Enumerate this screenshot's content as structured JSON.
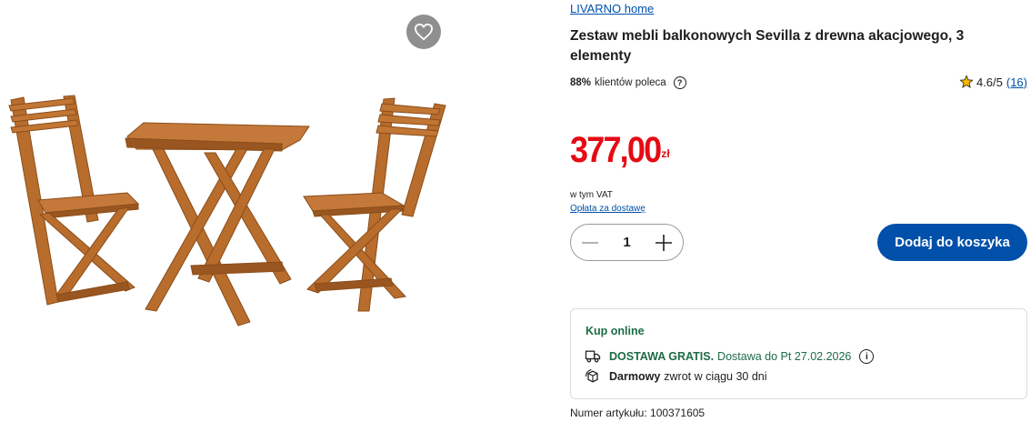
{
  "product": {
    "brand": "LIVARNO home",
    "title": "Zestaw mebli balkonowych Sevilla z drewna akacjowego, 3 elementy",
    "recommend_percent": "88%",
    "recommend_text": "klientów poleca",
    "rating": "4.6/5",
    "review_count": "(16)",
    "price": "377,00",
    "currency": "zł",
    "vat_note": "w tym VAT",
    "shipping_link": "Opłata za dostawę",
    "quantity": "1",
    "add_to_cart_label": "Dodaj do koszyka",
    "article_number": "Numer artykułu: 100371605"
  },
  "delivery": {
    "title": "Kup online",
    "free_shipping": "DOSTAWA GRATIS.",
    "delivery_date": "Dostawa do Pt 27.02.2026",
    "return_bold": "Darmowy",
    "return_text": "zwrot w ciągu 30 dni"
  },
  "icons": {
    "wishlist": "heart-icon",
    "help": "question-circle-icon",
    "star": "star-icon",
    "minus": "minus-icon",
    "plus": "plus-icon",
    "truck": "delivery-truck-icon",
    "return": "return-box-icon",
    "info": "info-icon"
  },
  "colors": {
    "brand_blue": "#0050aa",
    "price_red": "#e60a14",
    "delivery_green": "#1d6b45",
    "star_yellow": "#f5b800"
  }
}
